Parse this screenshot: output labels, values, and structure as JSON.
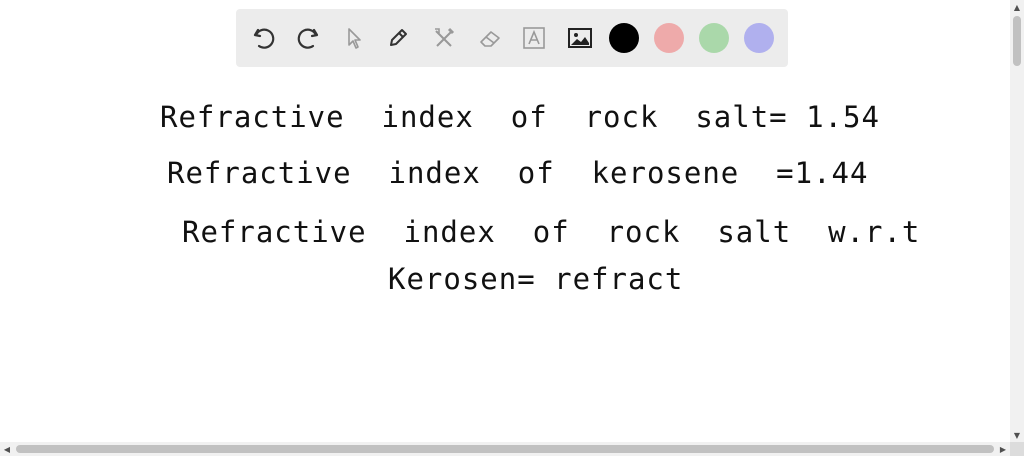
{
  "toolbar": {
    "tools": [
      {
        "name": "undo-icon",
        "state": "enabled"
      },
      {
        "name": "redo-icon",
        "state": "enabled"
      },
      {
        "name": "select-pointer-icon",
        "state": "disabled"
      },
      {
        "name": "pen-icon",
        "state": "enabled"
      },
      {
        "name": "tools-crossed-icon",
        "state": "disabled"
      },
      {
        "name": "eraser-icon",
        "state": "disabled"
      },
      {
        "name": "text-box-icon",
        "state": "disabled"
      },
      {
        "name": "image-icon",
        "state": "enabled"
      }
    ],
    "colors": [
      {
        "name": "black",
        "hex": "#000000",
        "selected": true
      },
      {
        "name": "red",
        "hex": "#eeaaaa",
        "selected": false
      },
      {
        "name": "green",
        "hex": "#aad8aa",
        "selected": false
      },
      {
        "name": "purple",
        "hex": "#b0b0ee",
        "selected": false
      }
    ]
  },
  "notes": {
    "line1": "Refractive  index  of  rock  salt= 1.54",
    "line2": "Refractive  index  of  kerosene  =1.44",
    "line3": "Refractive  index  of  rock  salt  w.r.t",
    "line4": "Kerosen= refract"
  }
}
